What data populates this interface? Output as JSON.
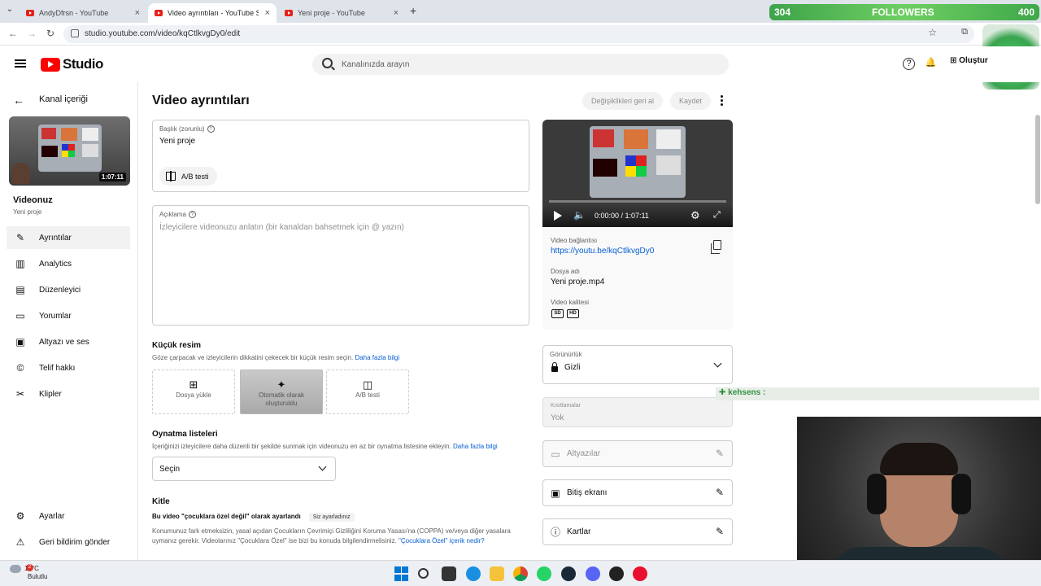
{
  "browser": {
    "tabs": [
      {
        "label": "AndyDfrsn - YouTube",
        "close": "×"
      },
      {
        "label": "Video ayrıntıları - YouTube Studio",
        "close": "×"
      },
      {
        "label": "Yeni proje - YouTube",
        "close": "×"
      }
    ],
    "new_tab": "+",
    "url": "studio.youtube.com/video/kqCtlkvgDy0/edit",
    "overlay": {
      "followers_label": "FOLLOWERS",
      "followers_left": "304",
      "followers_right": "400"
    }
  },
  "header": {
    "logo": "Studio",
    "search_placeholder": "Kanalınızda arayın",
    "create_label": "Oluştur"
  },
  "sidebar": {
    "back_label": "Kanal içeriği",
    "thumb_duration": "1:07:11",
    "video_heading": "Videonuz",
    "video_name": "Yeni proje",
    "items": [
      {
        "label": "Ayrıntılar",
        "icon": "pencil-icon"
      },
      {
        "label": "Analytics",
        "icon": "analytics-icon"
      },
      {
        "label": "Düzenleyici",
        "icon": "editor-icon"
      },
      {
        "label": "Yorumlar",
        "icon": "comments-icon"
      },
      {
        "label": "Altyazı ve ses",
        "icon": "subtitles-icon"
      },
      {
        "label": "Telif hakkı",
        "icon": "copyright-icon"
      },
      {
        "label": "Klipler",
        "icon": "scissors-icon"
      }
    ],
    "bottom": [
      {
        "label": "Ayarlar",
        "icon": "gear-icon"
      },
      {
        "label": "Geri bildirim gönder",
        "icon": "feedback-icon"
      }
    ]
  },
  "main": {
    "title": "Video ayrıntıları",
    "undo_label": "Değişiklikleri geri al",
    "save_label": "Kaydet",
    "title_field": {
      "label": "Başlık (zorunlu)",
      "value": "Yeni proje",
      "ab_label": "A/B testi"
    },
    "description_field": {
      "label": "Açıklama",
      "placeholder": "İzleyicilere videonuzu anlatın (bir kanaldan bahsetmek için @ yazın)"
    },
    "thumbnail": {
      "title": "Küçük resim",
      "desc": "Göze çarpacak ve izleyicilerin dikkatini çekecek bir küçük resim seçin.",
      "link": "Daha fazla bilgi",
      "options": [
        "Dosya yükle",
        "Otomatik olarak oluşturuldu",
        "A/B testi"
      ]
    },
    "playlists": {
      "title": "Oynatma listeleri",
      "desc": "İçeriğinizi izleyicilere daha düzenli bir şekilde sunmak için videonuzu en az bir oynatma listesine ekleyin.",
      "link": "Daha fazla bilgi",
      "select": "Seçin"
    },
    "audience": {
      "title": "Kitle",
      "status": "Bu video \"çocuklara özel değil\" olarak ayarlandı",
      "chip": "Siz ayarladınız",
      "desc": "Konumunuz fark etmeksizin, yasal açıdan Çocukların Çevrimiçi Gizliliğini Koruma Yasası'na (COPPA) ve/veya diğer yasalara uymanız gerekir. Videolarınız \"Çocuklara Özel\" ise bizi bu konuda bilgilendirmelisiniz.",
      "link": "\"Çocuklara Özel\" içerik nedir?"
    }
  },
  "right": {
    "player_time": "0:00:00 / 1:07:11",
    "link_label": "Video bağlantısı",
    "link_value": "https://youtu.be/kqCtlkvgDy0",
    "file_label": "Dosya adı",
    "file_value": "Yeni proje.mp4",
    "quality_label": "Video kalitesi",
    "quality_badges": [
      "SD",
      "HD"
    ],
    "visibility_label": "Görünürlük",
    "visibility_value": "Gizli",
    "restrictions_label": "Kısıtlamalar",
    "restrictions_value": "Yok",
    "subtitles_label": "Altyazılar",
    "endscreen_label": "Bitiş ekranı",
    "cards_label": "Kartlar"
  },
  "stream_overlay": {
    "chat_line": "✚ kehsens :"
  },
  "taskbar": {
    "temp": "12°C",
    "weather": "Bulutlu",
    "badge": "2"
  }
}
